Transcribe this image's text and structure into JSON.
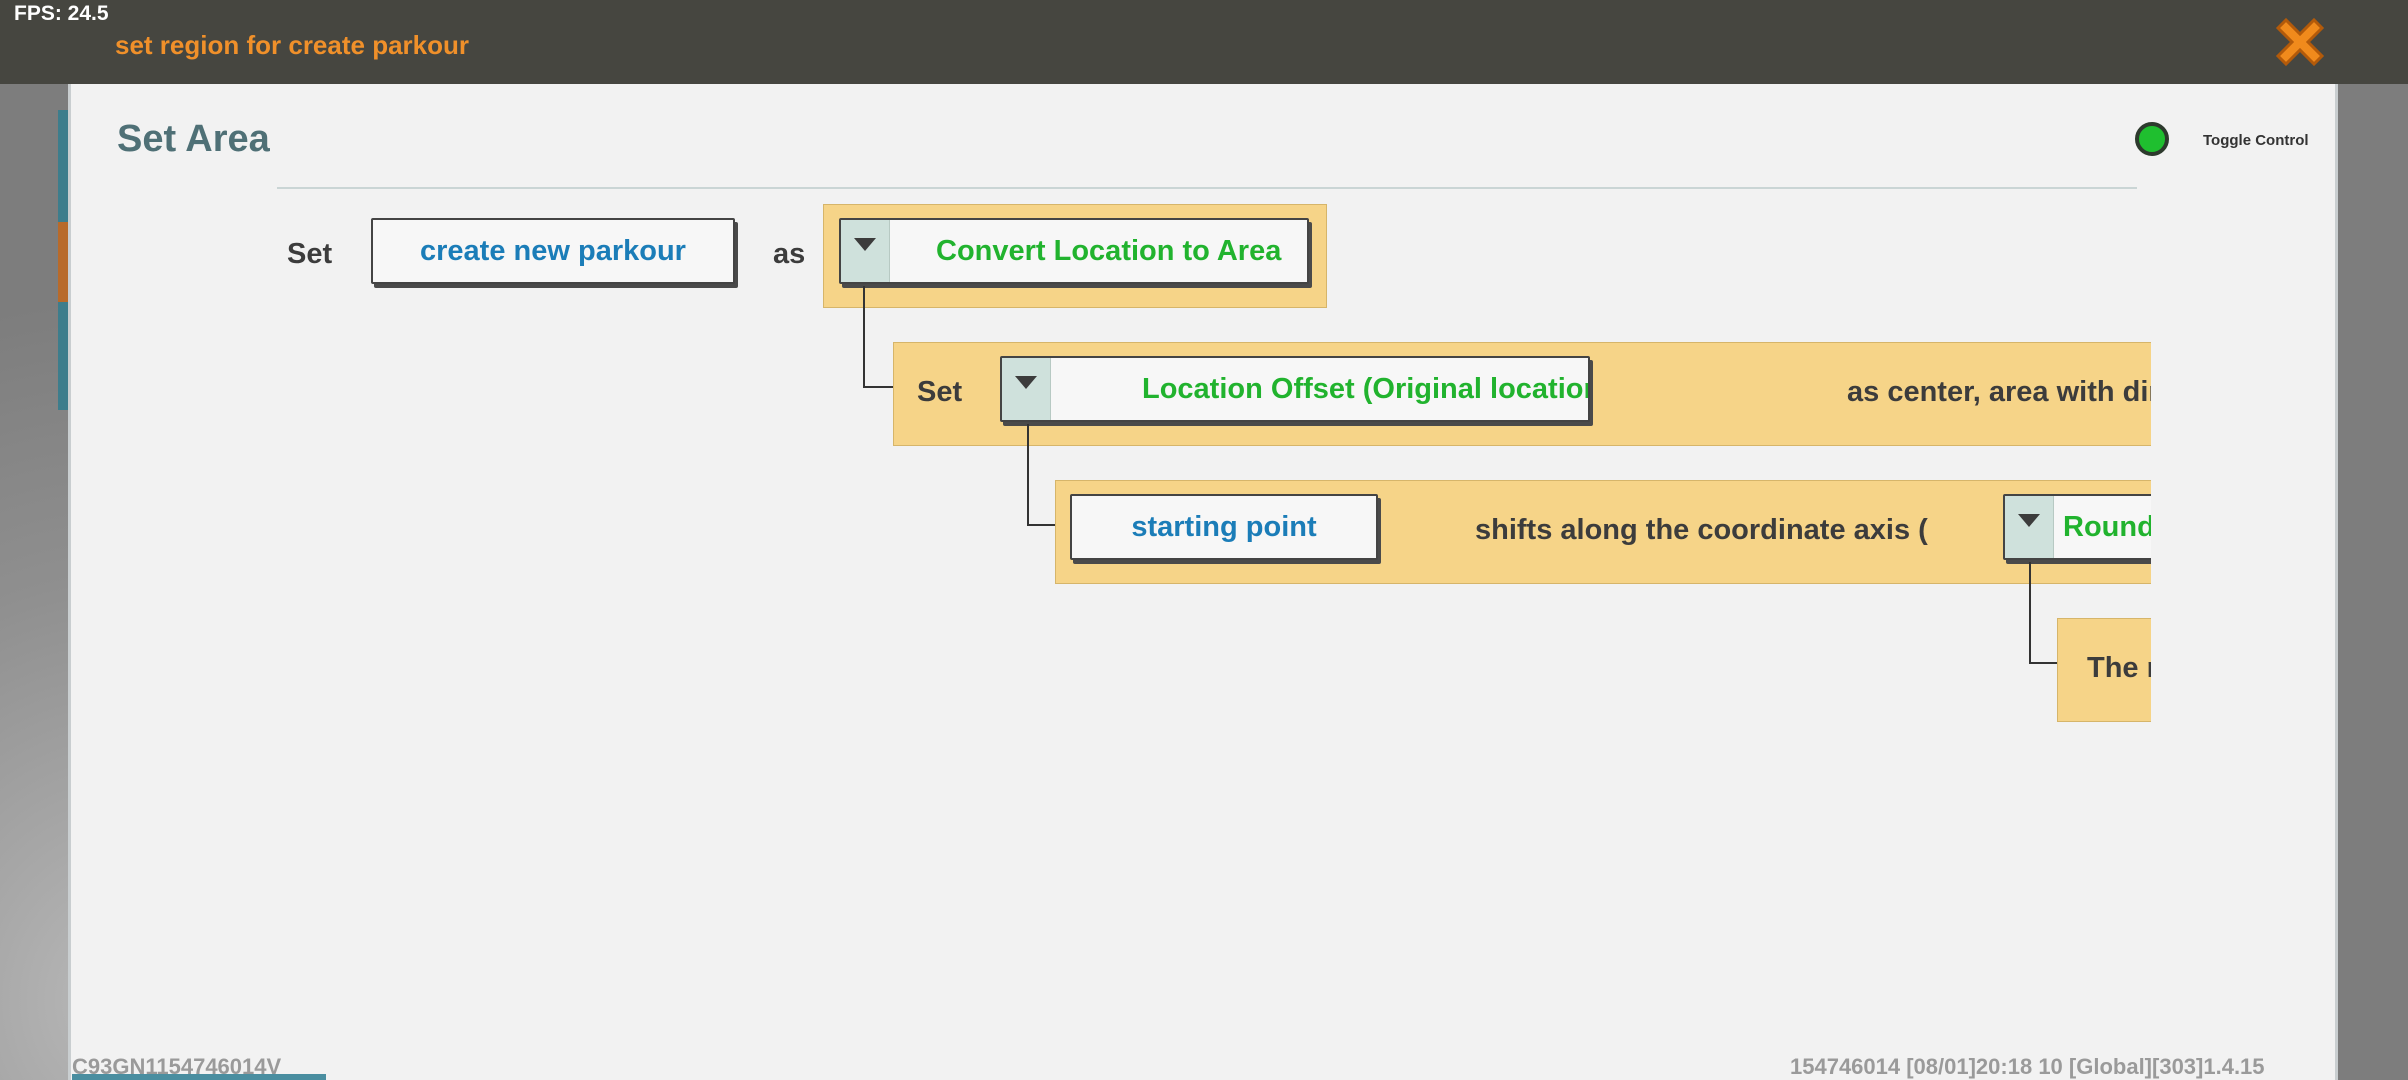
{
  "fps": "FPS: 24.5",
  "window": {
    "title": "set region for create parkour",
    "close_icon": "close-x-icon",
    "accent_color": "#f0902a"
  },
  "dialog": {
    "heading": "Set Area",
    "toggle_label": "Toggle Control",
    "toggle_color": "#1fbf2f"
  },
  "blocks": {
    "row1": {
      "set_label": "Set",
      "variable": "create new parkour",
      "as_label": "as",
      "function": "Convert Location to Area"
    },
    "row2": {
      "set_label": "Set",
      "function": "Location Offset (Original location fixed)",
      "suffix": "as center, area with dir"
    },
    "row3": {
      "variable": "starting point",
      "text": "shifts along the coordinate axis (",
      "function": "Round"
    },
    "row4": {
      "text": "The r"
    }
  },
  "footer": {
    "left": "C93GN1154746014V",
    "right": "154746014    [08/01]20:18 10   [Global][303]1.4.15"
  }
}
